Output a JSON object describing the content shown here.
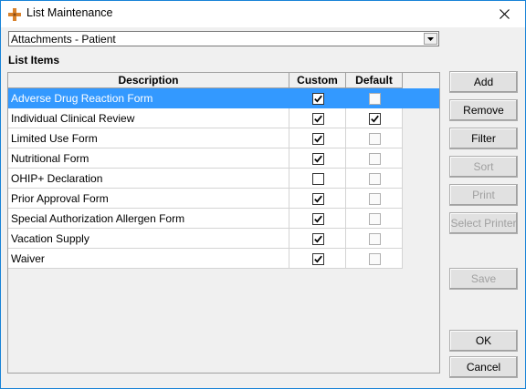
{
  "window": {
    "title": "List Maintenance"
  },
  "list_selector": {
    "value": "Attachments - Patient"
  },
  "section_label": "List Items",
  "grid": {
    "columns": [
      "Description",
      "Custom",
      "Default"
    ],
    "rows": [
      {
        "description": "Adverse Drug Reaction Form",
        "custom": true,
        "default": false,
        "selected": true,
        "default_enabled": false
      },
      {
        "description": "Individual Clinical Review",
        "custom": true,
        "default": true,
        "selected": false,
        "default_enabled": true
      },
      {
        "description": "Limited Use Form",
        "custom": true,
        "default": false,
        "selected": false,
        "default_enabled": false
      },
      {
        "description": "Nutritional Form",
        "custom": true,
        "default": false,
        "selected": false,
        "default_enabled": false
      },
      {
        "description": "OHIP+ Declaration",
        "custom": false,
        "default": false,
        "selected": false,
        "default_enabled": false
      },
      {
        "description": "Prior Approval Form",
        "custom": true,
        "default": false,
        "selected": false,
        "default_enabled": false
      },
      {
        "description": "Special Authorization Allergen Form",
        "custom": true,
        "default": false,
        "selected": false,
        "default_enabled": false
      },
      {
        "description": "Vacation Supply",
        "custom": true,
        "default": false,
        "selected": false,
        "default_enabled": false
      },
      {
        "description": "Waiver",
        "custom": true,
        "default": false,
        "selected": false,
        "default_enabled": false
      }
    ]
  },
  "buttons": {
    "add": {
      "label": "Add",
      "enabled": true
    },
    "remove": {
      "label": "Remove",
      "enabled": true
    },
    "filter": {
      "label": "Filter",
      "enabled": true
    },
    "sort": {
      "label": "Sort",
      "enabled": false
    },
    "print": {
      "label": "Print",
      "enabled": false
    },
    "select_printer": {
      "label": "Select Printer",
      "enabled": false
    },
    "save": {
      "label": "Save",
      "enabled": false
    },
    "ok": {
      "label": "OK",
      "enabled": true
    },
    "cancel": {
      "label": "Cancel",
      "enabled": true
    }
  },
  "colors": {
    "selection": "#3399ff",
    "window_border": "#1883d7",
    "dialog_bg": "#f0f0f0"
  },
  "icons": {
    "app": "app-icon",
    "close": "close-icon",
    "dropdown": "chevron-down-icon",
    "check": "checkmark-icon"
  }
}
